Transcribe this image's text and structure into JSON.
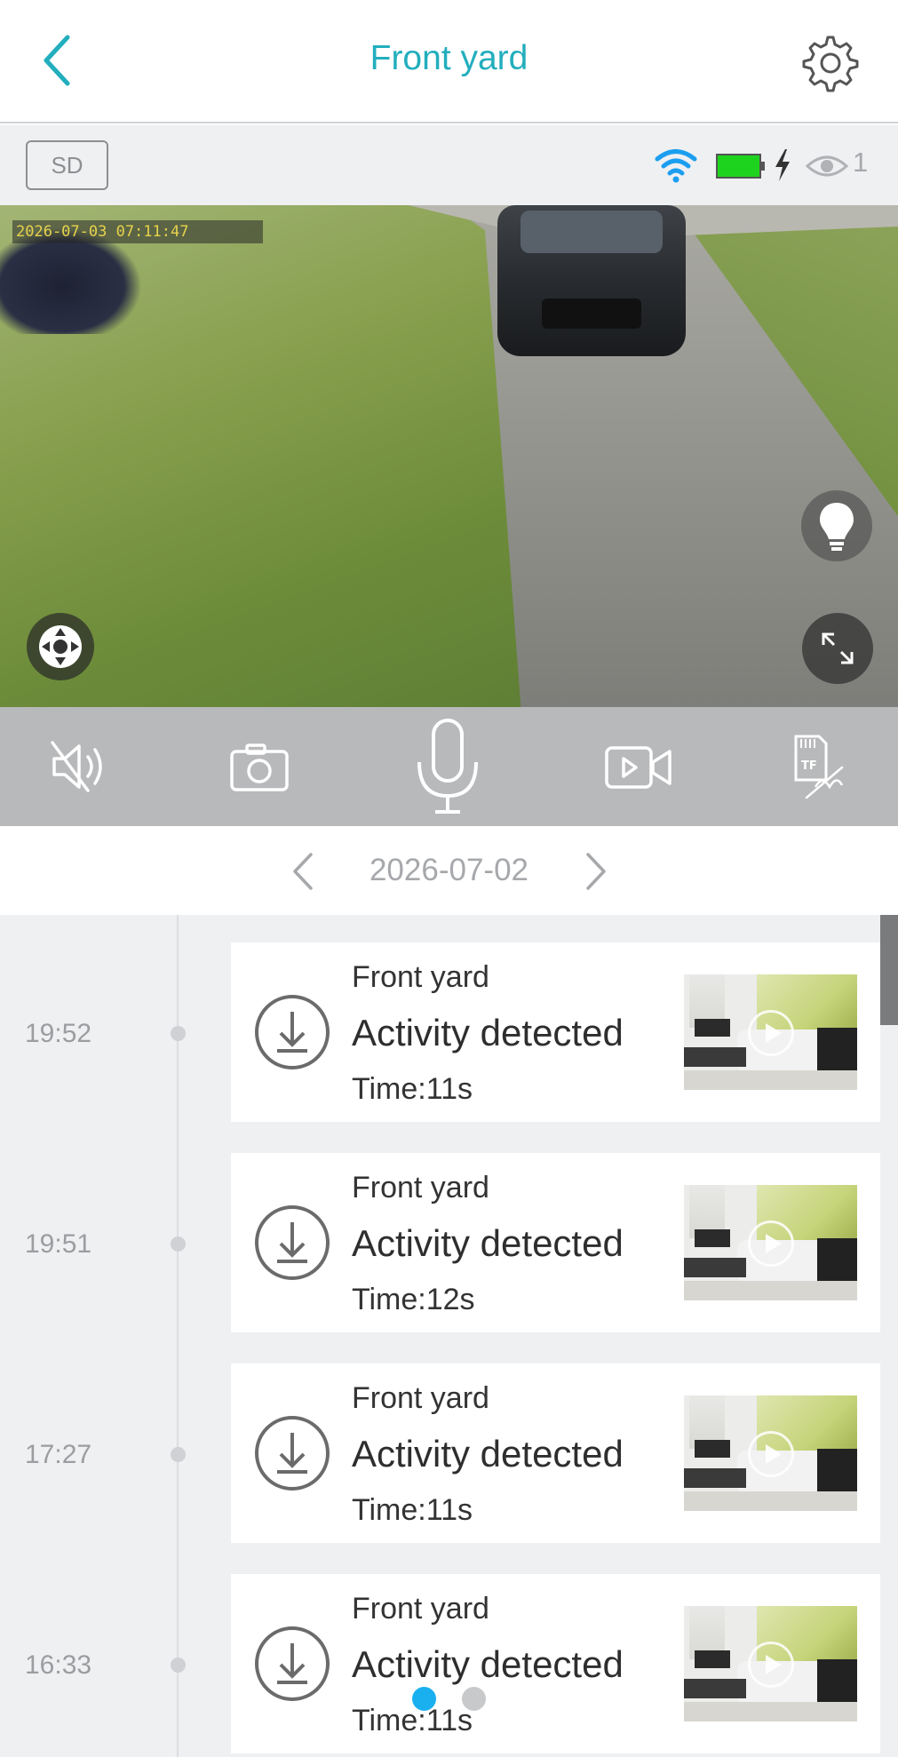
{
  "header": {
    "title": "Front yard"
  },
  "status": {
    "storage_label": "SD",
    "viewer_count": "1",
    "battery_color": "#1ed31e",
    "wifi_color": "#1c9ef0"
  },
  "video": {
    "timestamp": "2026-07-03 07:11:47"
  },
  "date_nav": {
    "date": "2026-07-02"
  },
  "events": [
    {
      "time": "19:52",
      "camera": "Front yard",
      "type": "Activity detected",
      "duration": "Time:11s"
    },
    {
      "time": "19:51",
      "camera": "Front yard",
      "type": "Activity detected",
      "duration": "Time:12s"
    },
    {
      "time": "17:27",
      "camera": "Front yard",
      "type": "Activity detected",
      "duration": "Time:11s"
    },
    {
      "time": "16:33",
      "camera": "Front yard",
      "type": "Activity detected",
      "duration": "Time:11s"
    }
  ],
  "colors": {
    "accent": "#22aebd",
    "active_dot": "#1ab0f0",
    "inactive_dot": "#c8c9cb"
  }
}
